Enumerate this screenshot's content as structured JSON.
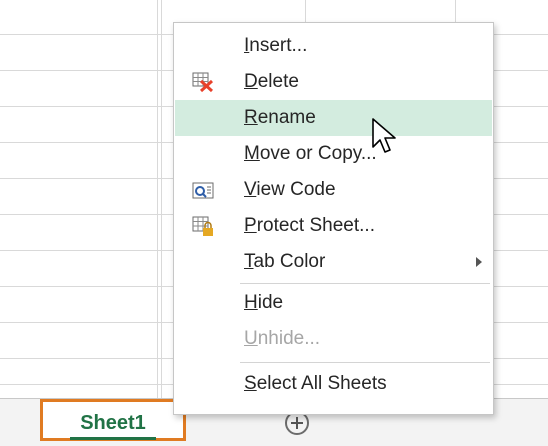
{
  "sheet_tabs": {
    "active_tab": "Sheet1",
    "add_sheet_icon": "plus-circle-icon"
  },
  "context_menu": {
    "items": [
      {
        "label": "Insert...",
        "mnemonic": "I",
        "icon": null,
        "state": "normal"
      },
      {
        "label": "Delete",
        "mnemonic": "D",
        "icon": "delete-sheet-icon",
        "state": "normal"
      },
      {
        "label": "Rename",
        "mnemonic": "R",
        "icon": null,
        "state": "hover"
      },
      {
        "label": "Move or Copy...",
        "mnemonic": "M",
        "icon": null,
        "state": "normal"
      },
      {
        "label": "View Code",
        "mnemonic": "V",
        "icon": "view-code-icon",
        "state": "normal"
      },
      {
        "label": "Protect Sheet...",
        "mnemonic": "P",
        "icon": "protect-sheet-icon",
        "state": "normal"
      },
      {
        "label": "Tab Color",
        "mnemonic": "T",
        "icon": null,
        "state": "normal",
        "submenu": true
      },
      {
        "label": "Hide",
        "mnemonic": "H",
        "icon": null,
        "state": "normal"
      },
      {
        "label": "Unhide...",
        "mnemonic": "U",
        "icon": null,
        "state": "disabled"
      },
      {
        "label": "Select All Sheets",
        "mnemonic": "S",
        "icon": null,
        "state": "normal"
      }
    ]
  },
  "colors": {
    "hover_highlight": "#d3ecdf",
    "excel_green": "#217346",
    "tab_outline": "#e07b22",
    "delete_icon_red": "#e8412b",
    "lock_gold": "#e5a823"
  }
}
